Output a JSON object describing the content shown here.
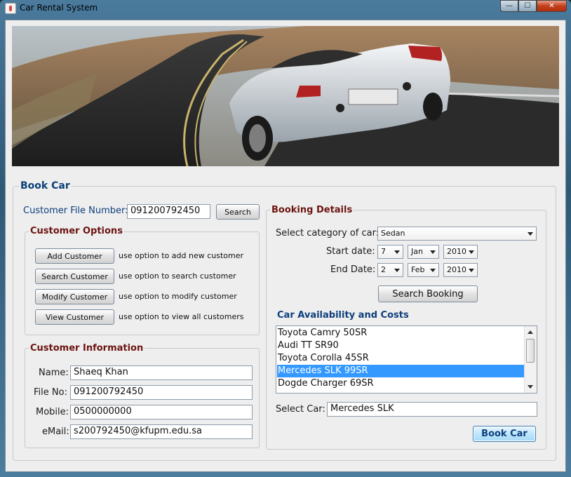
{
  "window": {
    "title": "Car Rental System",
    "min_glyph": "—",
    "max_glyph": "☐",
    "close_glyph": "✕"
  },
  "book_car_panel": {
    "title": "Book Car"
  },
  "customer_search": {
    "label": "Customer File Number:",
    "value": "091200792450",
    "search_label": "Search"
  },
  "customer_options": {
    "title": "Customer Options",
    "buttons": [
      {
        "label": "Add Customer",
        "hint": "use option to add new customer"
      },
      {
        "label": "Search Customer",
        "hint": "use option to search customer"
      },
      {
        "label": "Modify Customer",
        "hint": "use option to modify customer"
      },
      {
        "label": "View Customer",
        "hint": "use option to view all customers"
      }
    ]
  },
  "customer_info": {
    "title": "Customer Information",
    "fields": [
      {
        "label": "Name:",
        "value": "Shaeq Khan"
      },
      {
        "label": "File No:",
        "value": "091200792450"
      },
      {
        "label": "Mobile:",
        "value": "0500000000"
      },
      {
        "label": "eMail:",
        "value": "s200792450@kfupm.edu.sa"
      }
    ]
  },
  "booking": {
    "title": "Booking Details",
    "category_label": "Select category of car:",
    "category_value": "Sedan",
    "start_label": "Start date:",
    "start_day": "7",
    "start_month": "Jan",
    "start_year": "2010",
    "end_label": "End Date:",
    "end_day": "2",
    "end_month": "Feb",
    "end_year": "2010",
    "search_booking_label": "Search Booking"
  },
  "availability": {
    "title": "Car Availability and Costs",
    "items": [
      "Toyota Camry 50SR",
      "Audi TT SR90",
      "Toyota Corolla 45SR",
      "Mercedes SLK 99SR",
      "Dogde Charger 69SR"
    ],
    "selected_index": 3,
    "select_label": "Select Car:",
    "select_value": "Mercedes SLK",
    "book_label": "Book Car"
  },
  "colors": {
    "accent_title": "#0b3f7a",
    "section_title": "#6b1410",
    "selection": "#3399ff"
  }
}
